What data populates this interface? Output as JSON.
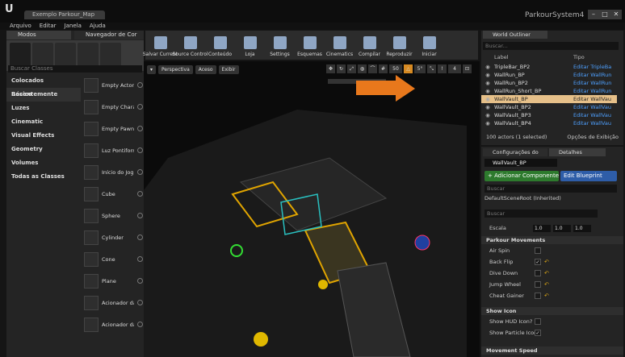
{
  "window": {
    "doc_tab": "Exemplo Parkour_Map",
    "project_name": "ParkourSystem4",
    "controls": [
      "–",
      "□",
      "✕"
    ]
  },
  "menu": [
    "Arquivo",
    "Editar",
    "Janela",
    "Ajuda"
  ],
  "left_panel": {
    "tabs": [
      "Modos",
      "Navegador de Cor"
    ],
    "search_placeholder": "Buscar Classes",
    "categories": [
      "Colocados Recentemente",
      "Básico",
      "Luzes",
      "Cinematic",
      "Visual Effects",
      "Geometry",
      "Volumes",
      "Todas as Classes"
    ],
    "active_category": "Básico",
    "classes": [
      "Empty Actor",
      "Empty Chara",
      "Empty Pawn",
      "Luz Pontiform",
      "Início do Jog",
      "Cube",
      "Sphere",
      "Cylinder",
      "Cone",
      "Plane",
      "Acionador da",
      "Acionador da"
    ]
  },
  "toolbar": {
    "buttons": [
      "Salvar Current",
      "Source Control",
      "Conteúdo",
      "Loja",
      "Settings",
      "Esquemas",
      "Cinematics",
      "Compilar",
      "Reproduzir",
      "Iniciar"
    ]
  },
  "viewport": {
    "chips": [
      "Perspectiva",
      "Aceso",
      "Exibir"
    ],
    "grid_snap": "50",
    "angle_snap": "5°",
    "cam_speed": "4"
  },
  "outliner": {
    "tab": "World Outliner",
    "search_placeholder": "Buscar...",
    "columns": [
      "Label",
      "Tipo"
    ],
    "rows": [
      {
        "label": "TripleBar_BP2",
        "type": "Editar TripleBa"
      },
      {
        "label": "WallRun_BP",
        "type": "Editar WallRun"
      },
      {
        "label": "WallRun_BP2",
        "type": "Editar WallRun"
      },
      {
        "label": "WallRun_Short_BP",
        "type": "Editar WallRun"
      },
      {
        "label": "WallVault_BP",
        "type": "Editar WallVau"
      },
      {
        "label": "WallVault_BP2",
        "type": "Editar WallVau"
      },
      {
        "label": "WallVault_BP3",
        "type": "Editar WallVau"
      },
      {
        "label": "WallVault_BP4",
        "type": "Editar WallVau"
      }
    ],
    "selected_index": 4,
    "footer_count": "100 actors (1 selected)",
    "footer_options": "Opções de Exibição"
  },
  "details": {
    "tabs": [
      "Configurações do",
      "Detalhes"
    ],
    "name": "WallVault_BP",
    "add_component": "+ Adicionar Componente",
    "edit_blueprint": "Edit Blueprint",
    "search1": "Buscar",
    "scene_root": "DefaultSceneRoot (Inherited)",
    "search2": "Buscar",
    "scale_label": "Escala",
    "scale": [
      "1.0",
      "1.0",
      "1.0"
    ],
    "sections": [
      {
        "title": "Parkour Movements",
        "props": [
          {
            "label": "Air Spin",
            "checked": false
          },
          {
            "label": "Back Flip",
            "checked": true
          },
          {
            "label": "Dive Down",
            "checked": false
          },
          {
            "label": "Jump Wheel",
            "checked": false
          },
          {
            "label": "Cheat Gainer",
            "checked": false
          }
        ]
      },
      {
        "title": "Show Icon",
        "props": [
          {
            "label": "Show HUD Icon?",
            "checked": false
          },
          {
            "label": "Show Particle Icon?",
            "checked": true
          }
        ]
      },
      {
        "title": "Movement Speed",
        "props": []
      }
    ]
  },
  "colors": {
    "accent_orange": "#e8781c",
    "selection": "#e6c089",
    "link_blue": "#4ea0ff",
    "add_green": "#2d7a2d",
    "edit_blue": "#2e5da8"
  }
}
